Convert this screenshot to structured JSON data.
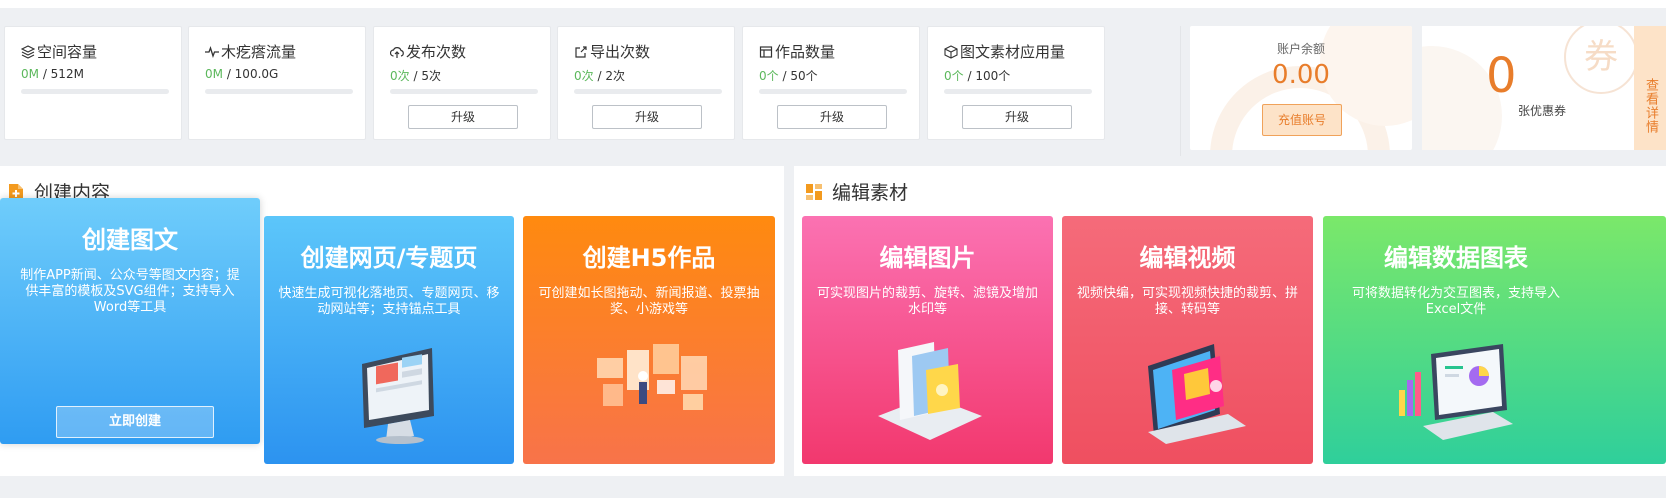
{
  "stats": [
    {
      "title": "空间容量",
      "icon": "layers-icon",
      "used": "0M",
      "total": " / 512M",
      "button": ""
    },
    {
      "title": "木疙瘩流量",
      "icon": "pulse-icon",
      "used": "0M",
      "total": " / 100.0G",
      "button": ""
    },
    {
      "title": "发布次数",
      "icon": "cloud-upload-icon",
      "used": "0次",
      "total": " / 5次",
      "button": "升级"
    },
    {
      "title": "导出次数",
      "icon": "export-icon",
      "used": "0次",
      "total": " / 2次",
      "button": "升级"
    },
    {
      "title": "作品数量",
      "icon": "works-icon",
      "used": "0个",
      "total": " / 50个",
      "button": "升级"
    },
    {
      "title": "图文素材应用量",
      "icon": "cube-icon",
      "used": "0个",
      "total": " / 100个",
      "button": "升级"
    }
  ],
  "balance": {
    "label": "账户余额",
    "amount": "0.00",
    "button": "充值账号"
  },
  "coupon": {
    "count": "0",
    "label": "张优惠券",
    "link": "查看详情",
    "stamp": "券"
  },
  "create_panel": {
    "title": "创建内容"
  },
  "edit_panel": {
    "title": "编辑素材"
  },
  "tiles": [
    {
      "title": "创建图文",
      "desc": "制作APP新闻、公众号等图文内容；提供丰富的模板及SVG组件；支持导入Word等工具",
      "button": "立即创建"
    },
    {
      "title": "创建网页/专题页",
      "desc": "快速生成可视化落地页、专题网页、移动网站等；支持锚点工具"
    },
    {
      "title": "创建H5作品",
      "desc": "可创建如长图拖动、新闻报道、投票抽奖、小游戏等"
    },
    {
      "title": "编辑图片",
      "desc": "可实现图片的裁剪、旋转、滤镜及增加水印等"
    },
    {
      "title": "编辑视频",
      "desc": "视频快编，可实现视频快捷的裁剪、拼接、转码等"
    },
    {
      "title": "编辑数据图表",
      "desc": "可将数据转化为交互图表，支持导入Excel文件"
    }
  ],
  "colors": {
    "accent": "#e87d2b",
    "used": "#5cb85c"
  }
}
